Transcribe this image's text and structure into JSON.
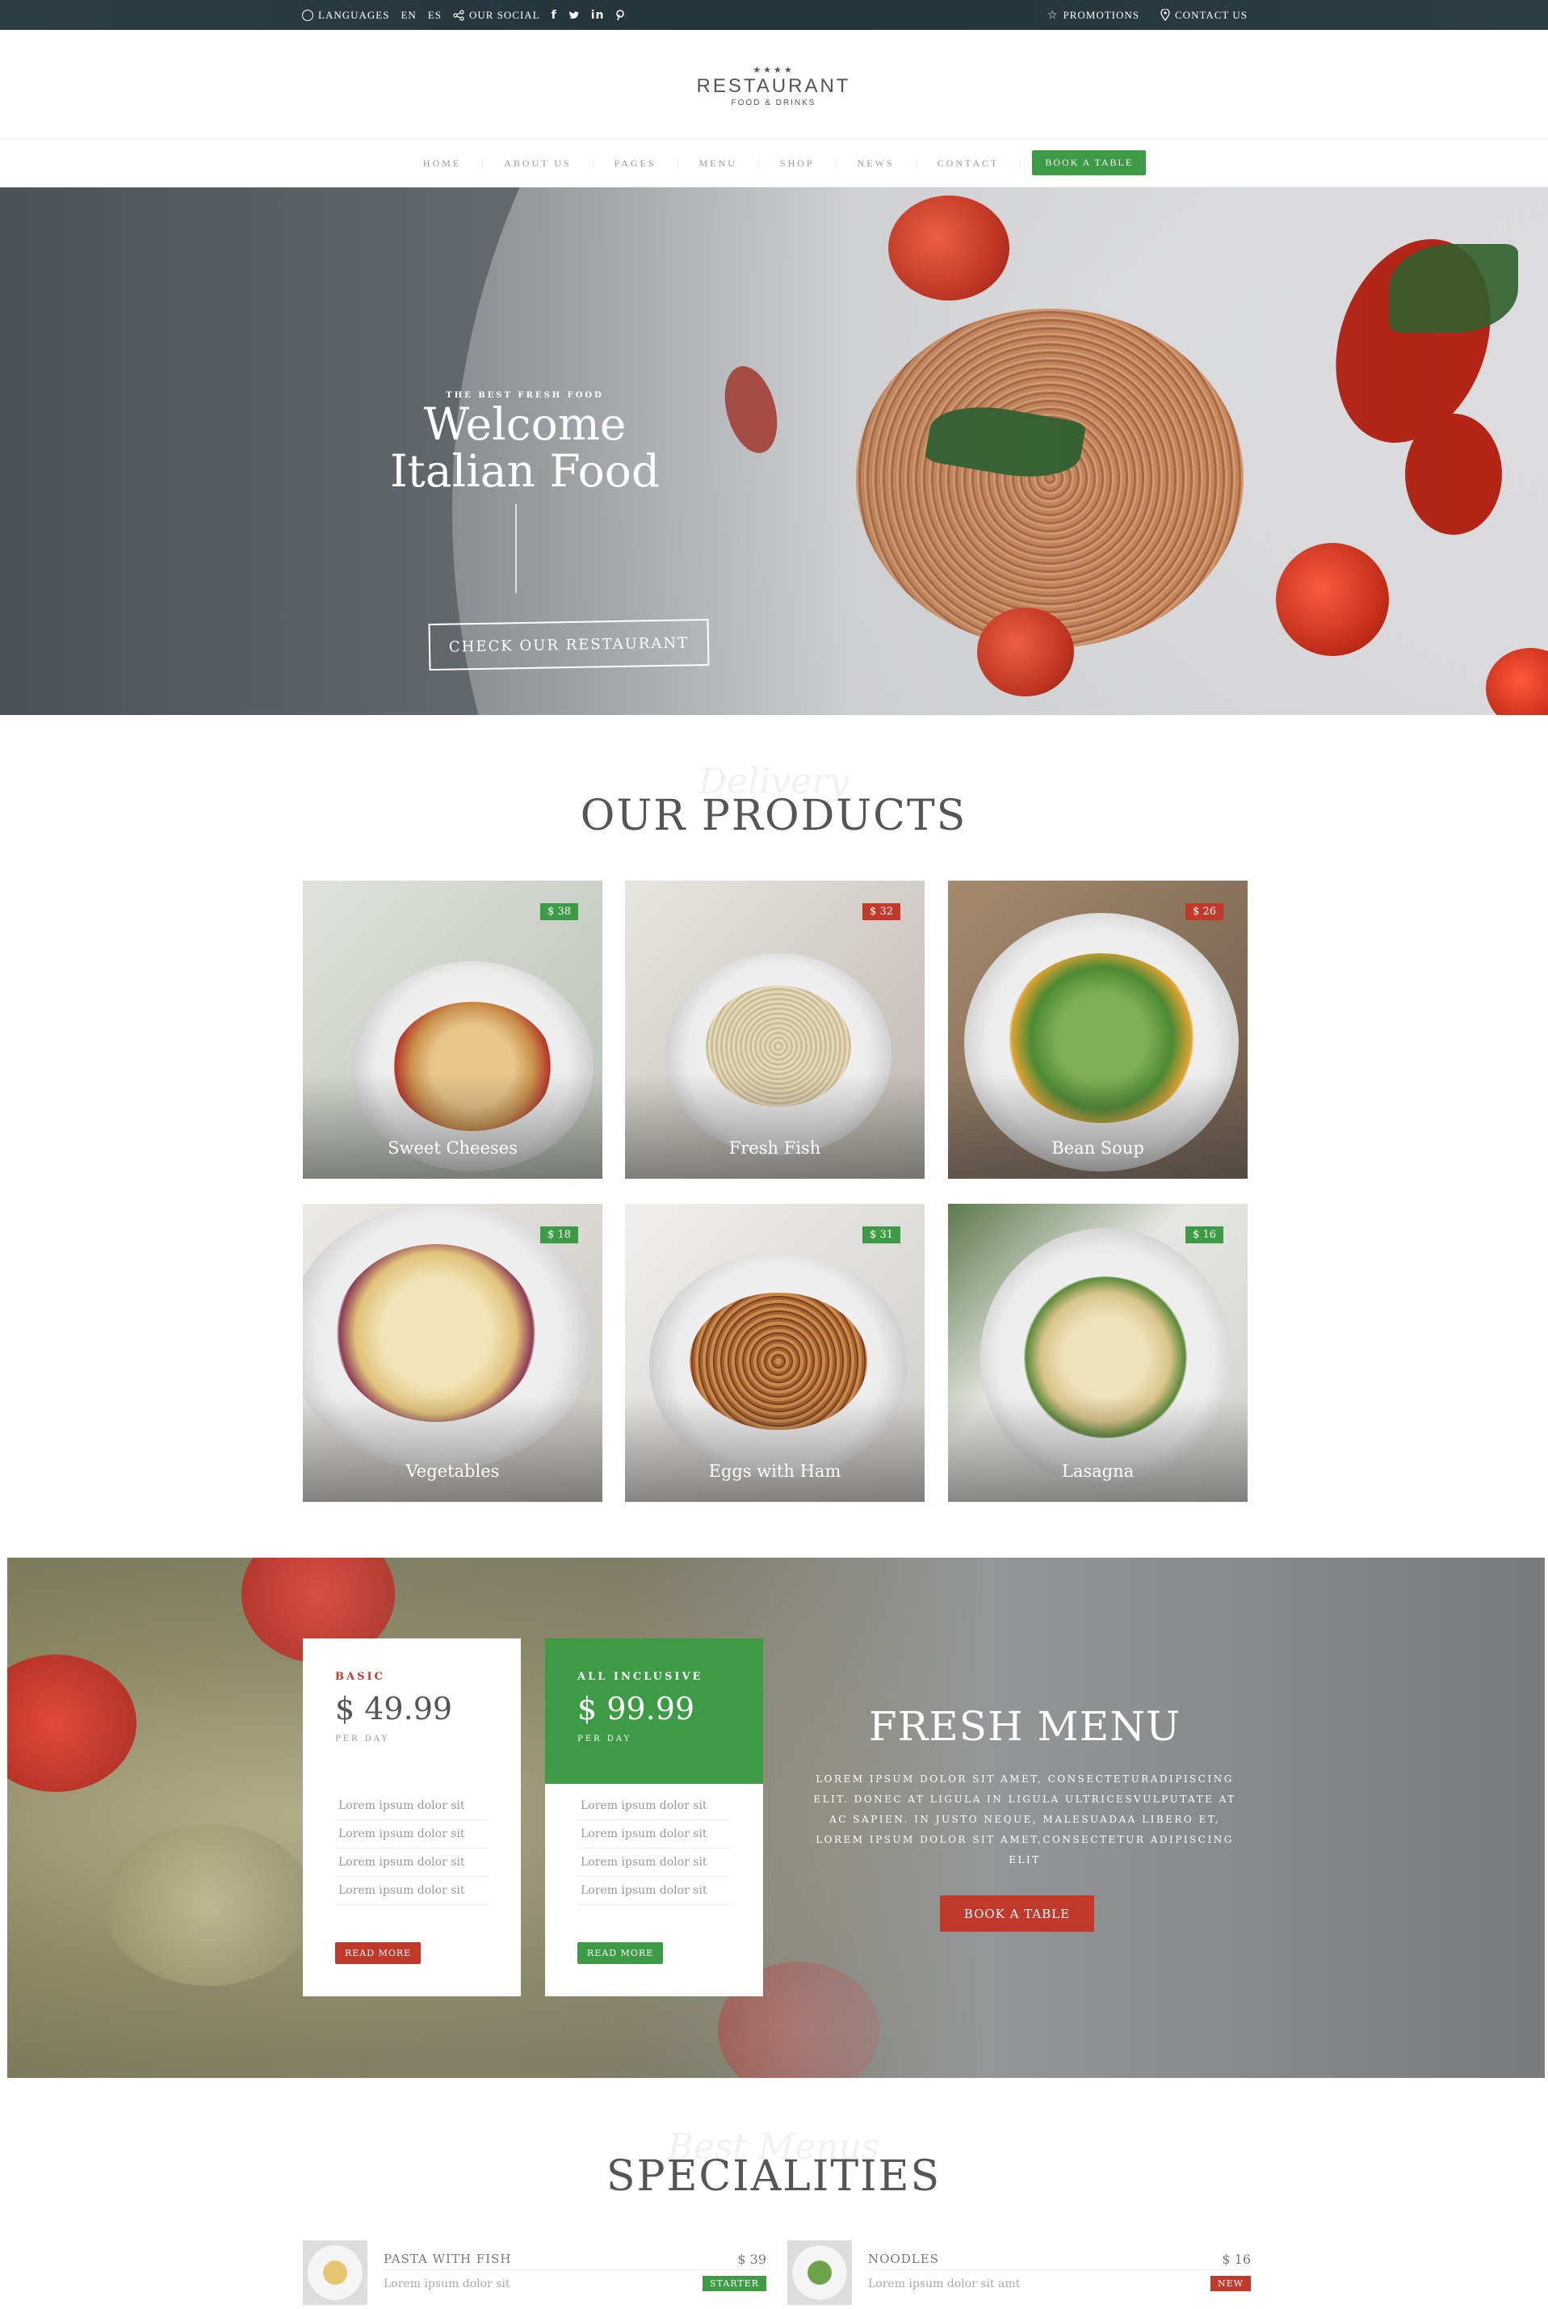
{
  "topbar": {
    "languages": "LANGUAGES",
    "lang_en": "EN",
    "lang_es": "ES",
    "social": "OUR SOCIAL",
    "promotions": "PROMOTIONS",
    "contact": "CONTACT US"
  },
  "logo": {
    "stars": "★★★★",
    "name": "RESTAURANT",
    "sub": "FOOD & DRINKS"
  },
  "nav": {
    "items": [
      "HOME",
      "ABOUT US",
      "PAGES",
      "MENU",
      "SHOP",
      "NEWS",
      "CONTACT"
    ],
    "book": "BOOK A TABLE"
  },
  "hero": {
    "kicker": "THE BEST FRESH FOOD",
    "title_line1": "Welcome",
    "title_line2": "Italian Food",
    "cta": "CHECK OUR RESTAURANT"
  },
  "products": {
    "script": "Delivery",
    "title": "OUR PRODUCTS",
    "items": [
      {
        "name": "Sweet Cheeses",
        "price": "$ 38",
        "badge": "green"
      },
      {
        "name": "Fresh Fish",
        "price": "$ 32",
        "badge": "red"
      },
      {
        "name": "Bean Soup",
        "price": "$ 26",
        "badge": "red"
      },
      {
        "name": "Vegetables",
        "price": "$ 18",
        "badge": "green"
      },
      {
        "name": "Eggs with Ham",
        "price": "$ 31",
        "badge": "green"
      },
      {
        "name": "Lasagna",
        "price": "$ 16",
        "badge": "green"
      }
    ]
  },
  "plans": [
    {
      "title": "BASIC",
      "amount": "$ 49.99",
      "per": "PER DAY",
      "features": [
        "Lorem ipsum dolor sit",
        "Lorem ipsum dolor sit",
        "Lorem ipsum dolor sit",
        "Lorem ipsum dolor sit"
      ],
      "button": "READ MORE"
    },
    {
      "title": "ALL INCLUSIVE",
      "amount": "$ 99.99",
      "per": "PER DAY",
      "features": [
        "Lorem ipsum dolor sit",
        "Lorem ipsum dolor sit",
        "Lorem ipsum dolor sit",
        "Lorem ipsum dolor sit"
      ],
      "button": "READ MORE"
    }
  ],
  "fresh_menu": {
    "title": "FRESH MENU",
    "text": "Lorem ipsum dolor sit amet, consecteturadipiscing elit. Donec at ligula in ligula ultricesvulputate at ac sapien. In justo neque, malesuadaa libero et, lorem ipsum dolor sit amet,consectetur adipiscing elit",
    "button": "BOOK A TABLE"
  },
  "specialities": {
    "script": "Best Menus",
    "title": "SPECIALITIES",
    "items": [
      {
        "name": "PASTA WITH FISH",
        "price": "$ 39",
        "desc": "Lorem ipsum dolor sit",
        "tag": "STARTER"
      },
      {
        "name": "NOODLES",
        "price": "$ 16",
        "desc": "Lorem ipsum dolor sit amt",
        "tag": "NEW"
      }
    ]
  },
  "colors": {
    "accent_green": "#3d9b45",
    "accent_red": "#c0392b",
    "topbar": "#22343a"
  }
}
